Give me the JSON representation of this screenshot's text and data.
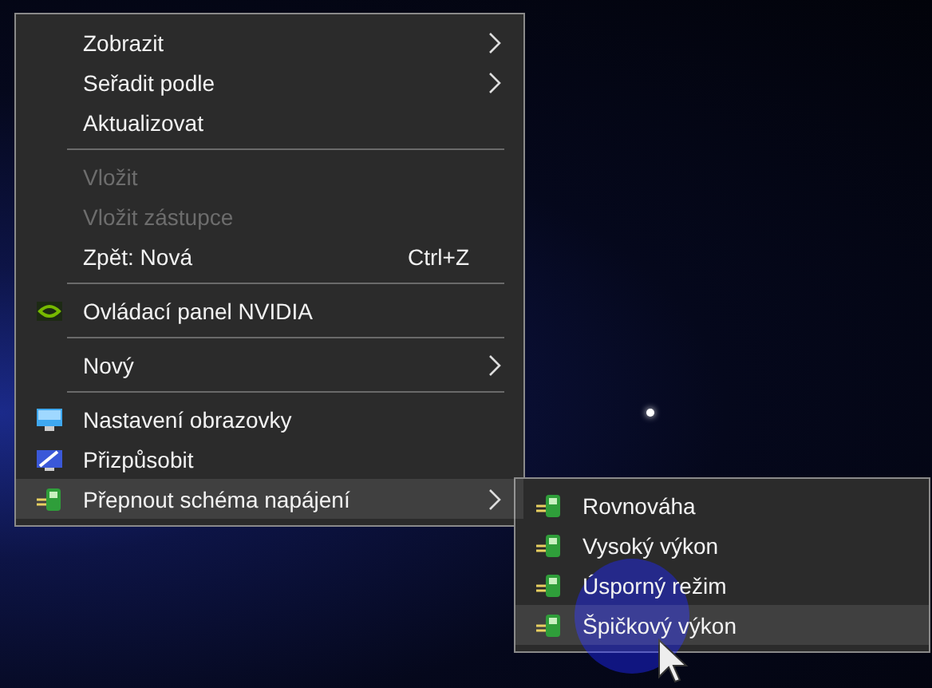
{
  "context_menu": {
    "items": [
      {
        "kind": "item",
        "label": "Zobrazit",
        "submenu": true,
        "disabled": false,
        "selected": false
      },
      {
        "kind": "item",
        "label": "Seřadit podle",
        "submenu": true,
        "disabled": false,
        "selected": false
      },
      {
        "kind": "item",
        "label": "Aktualizovat",
        "submenu": false,
        "disabled": false,
        "selected": false
      },
      {
        "kind": "separator"
      },
      {
        "kind": "item",
        "label": "Vložit",
        "submenu": false,
        "disabled": true,
        "selected": false
      },
      {
        "kind": "item",
        "label": "Vložit zástupce",
        "submenu": false,
        "disabled": true,
        "selected": false
      },
      {
        "kind": "item",
        "label": "Zpět: Nová",
        "shortcut": "Ctrl+Z",
        "submenu": false,
        "disabled": false,
        "selected": false
      },
      {
        "kind": "separator"
      },
      {
        "kind": "item",
        "label": "Ovládací panel NVIDIA",
        "submenu": false,
        "disabled": false,
        "selected": false
      },
      {
        "kind": "separator"
      },
      {
        "kind": "item",
        "label": "Nový",
        "submenu": true,
        "disabled": false,
        "selected": false
      },
      {
        "kind": "separator"
      },
      {
        "kind": "item",
        "label": "Nastavení obrazovky",
        "submenu": false,
        "disabled": false,
        "selected": false
      },
      {
        "kind": "item",
        "label": "Přizpůsobit",
        "submenu": false,
        "disabled": false,
        "selected": false
      },
      {
        "kind": "item",
        "label": "Přepnout schéma napájení",
        "submenu": true,
        "disabled": false,
        "selected": true
      }
    ]
  },
  "submenu": {
    "items": [
      {
        "label": "Rovnováha",
        "selected": false
      },
      {
        "label": "Vysoký výkon",
        "selected": false
      },
      {
        "label": "Úsporný režim",
        "selected": false
      },
      {
        "label": "Špičkový výkon",
        "selected": true
      }
    ]
  }
}
